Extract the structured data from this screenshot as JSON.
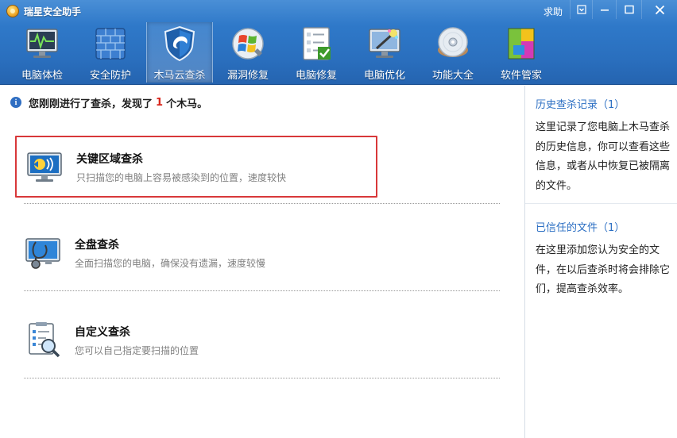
{
  "window": {
    "title": "瑞星安全助手",
    "help_label": "求助",
    "controls": [
      "menu-icon",
      "minimize-icon",
      "maximize-icon",
      "close-icon"
    ]
  },
  "toolbar": {
    "active_index": 2,
    "items": [
      {
        "label": "电脑体检",
        "icon": "pc-checkup-icon"
      },
      {
        "label": "安全防护",
        "icon": "firewall-icon"
      },
      {
        "label": "木马云查杀",
        "icon": "shield-cloud-icon"
      },
      {
        "label": "漏洞修复",
        "icon": "windows-patch-icon"
      },
      {
        "label": "电脑修复",
        "icon": "checklist-icon"
      },
      {
        "label": "电脑优化",
        "icon": "magic-wand-icon"
      },
      {
        "label": "功能大全",
        "icon": "disc-icon"
      },
      {
        "label": "软件管家",
        "icon": "software-blocks-icon"
      }
    ]
  },
  "notice": {
    "prefix": "您刚刚进行了查杀，发现了",
    "count": "1",
    "suffix": "个木马。",
    "icon": "info-icon"
  },
  "scan_options": [
    {
      "title": "关键区域查杀",
      "desc": "只扫描您的电脑上容易被感染到的位置，速度较快",
      "icon": "monitor-scan-icon",
      "selected": true
    },
    {
      "title": "全盘查杀",
      "desc": "全面扫描您的电脑，确保没有遗漏，速度较慢",
      "icon": "monitor-stethoscope-icon",
      "selected": false
    },
    {
      "title": "自定义查杀",
      "desc": "您可以自己指定要扫描的位置",
      "icon": "clipboard-magnifier-icon",
      "selected": false
    }
  ],
  "sidebar": {
    "history_title": "历史查杀记录（1）",
    "history_text": "这里记录了您电脑上木马查杀的历史信息，你可以查看这些信息，或者从中恢复已被隔离的文件。",
    "trusted_title": "已信任的文件（1）",
    "trusted_text": "在这里添加您认为安全的文件，在以后查杀时将会排除它们，提高查杀效率。"
  },
  "colors": {
    "toolbar_blue": "#2f79c9",
    "link_blue": "#2c6fc3",
    "alert_red": "#d9261c",
    "selection_red": "#d8383a"
  }
}
